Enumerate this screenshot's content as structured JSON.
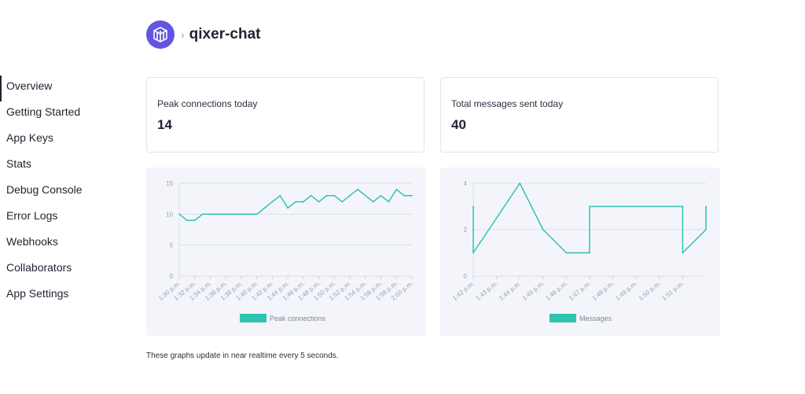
{
  "app": {
    "name": "qixer-chat",
    "logo_icon": "stacked-layers-icon",
    "accent": "#6255e0",
    "chevron_icon": "chevron-right-icon"
  },
  "sidebar": {
    "items": [
      {
        "label": "Overview",
        "active": true
      },
      {
        "label": "Getting Started"
      },
      {
        "label": "App Keys"
      },
      {
        "label": "Stats"
      },
      {
        "label": "Debug Console"
      },
      {
        "label": "Error Logs"
      },
      {
        "label": "Webhooks"
      },
      {
        "label": "Collaborators"
      },
      {
        "label": "App Settings"
      }
    ]
  },
  "stats": {
    "peak": {
      "label": "Peak connections today",
      "value": "14"
    },
    "messages": {
      "label": "Total messages sent today",
      "value": "40"
    }
  },
  "footer_note": "These graphs update in near realtime every 5 seconds.",
  "chart_data": [
    {
      "type": "line",
      "series": [
        {
          "name": "Peak connections",
          "color": "#2ec4b0",
          "x": [
            "1:30 p.m.",
            "1:31 p.m.",
            "1:32 p.m.",
            "1:33 p.m.",
            "1:34 p.m.",
            "1:35 p.m.",
            "1:36 p.m.",
            "1:37 p.m.",
            "1:38 p.m.",
            "1:39 p.m.",
            "1:40 p.m.",
            "1:41 p.m.",
            "1:42 p.m.",
            "1:43 p.m.",
            "1:44 p.m.",
            "1:45 p.m.",
            "1:46 p.m.",
            "1:47 p.m.",
            "1:48 p.m.",
            "1:49 p.m.",
            "1:50 p.m.",
            "1:51 p.m.",
            "1:52 p.m.",
            "1:53 p.m.",
            "1:54 p.m.",
            "1:55 p.m.",
            "1:56 p.m.",
            "1:57 p.m.",
            "1:58 p.m.",
            "1:59 p.m.",
            "2:00 p.m."
          ],
          "values": [
            10,
            9,
            9,
            10,
            10,
            10,
            10,
            10,
            10,
            10,
            10,
            11,
            12,
            13,
            11,
            12,
            12,
            13,
            12,
            13,
            13,
            12,
            13,
            14,
            13,
            12,
            13,
            12,
            14,
            13,
            13
          ]
        }
      ],
      "tick_labels": [
        "1:30 p.m.",
        "1:32 p.m.",
        "1:34 p.m.",
        "1:36 p.m.",
        "1:38 p.m.",
        "1:40 p.m.",
        "1:42 p.m.",
        "1:44 p.m.",
        "1:46 p.m.",
        "1:48 p.m.",
        "1:50 p.m.",
        "1:52 p.m.",
        "1:54 p.m.",
        "1:56 p.m.",
        "1:58 p.m.",
        "2:00 p.m."
      ],
      "y_ticks": [
        0,
        5,
        10,
        15
      ],
      "ylim": [
        0,
        15
      ],
      "grid": true,
      "legend_position": "bottom"
    },
    {
      "type": "line",
      "series": [
        {
          "name": "Messages",
          "color": "#2ec4b0",
          "x": [
            "1:42 p.m.",
            "1:42 p.m.",
            "1:44 p.m.",
            "1:45 p.m.",
            "1:46 p.m.",
            "1:47 p.m.",
            "1:47 p.m.",
            "1:48 p.m.",
            "1:49 p.m.",
            "1:50 p.m.",
            "1:51 p.m.",
            "1:51 p.m.",
            "1:52 p.m.",
            "1:52 p.m."
          ],
          "values": [
            3,
            1,
            4,
            2,
            1,
            1,
            3,
            3,
            3,
            3,
            3,
            1,
            2,
            3
          ]
        }
      ],
      "tick_labels": [
        "1:42 p.m.",
        "1:43 p.m.",
        "1:44 p.m.",
        "1:45 p.m.",
        "1:46 p.m.",
        "1:47 p.m.",
        "1:48 p.m.",
        "1:49 p.m.",
        "1:50 p.m.",
        "1:51 p.m."
      ],
      "y_ticks": [
        0,
        2,
        4
      ],
      "ylim": [
        0,
        4
      ],
      "grid": true,
      "legend_position": "bottom"
    }
  ]
}
